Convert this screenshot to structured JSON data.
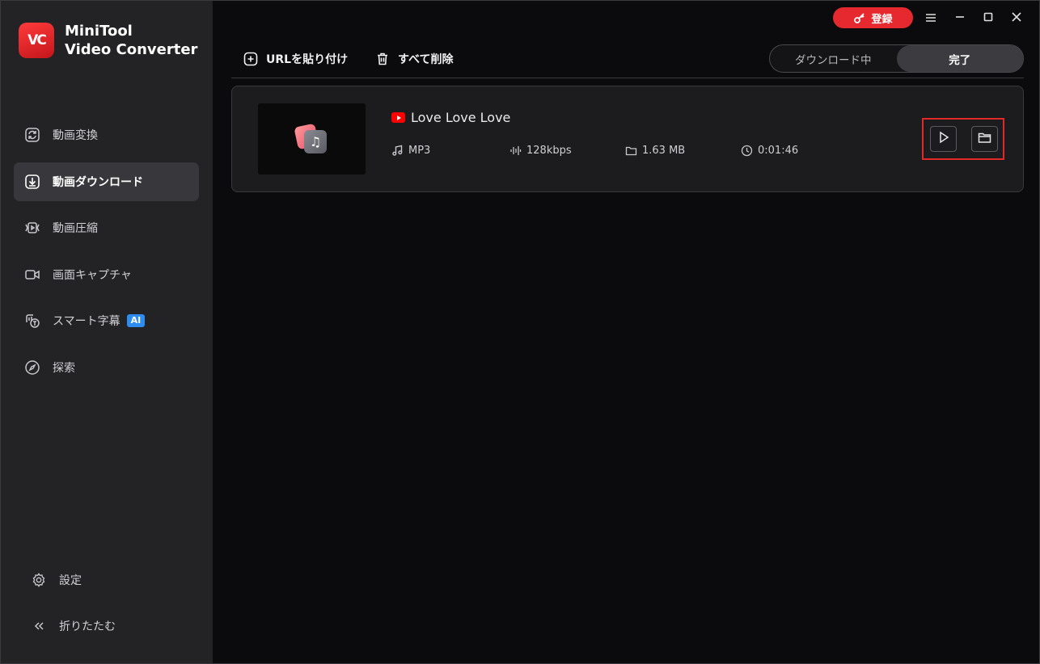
{
  "app": {
    "logo_mark": "VC",
    "name_line1": "MiniTool",
    "name_line2": "Video Converter"
  },
  "sidebar": {
    "items": [
      {
        "label": "動画変換",
        "icon": "refresh-icon"
      },
      {
        "label": "動画ダウンロード",
        "icon": "download-icon",
        "active": true
      },
      {
        "label": "動画圧縮",
        "icon": "compress-icon"
      },
      {
        "label": "画面キャプチャ",
        "icon": "camera-icon"
      },
      {
        "label": "スマート字幕",
        "icon": "subtitle-icon",
        "badge": "AI"
      },
      {
        "label": "探索",
        "icon": "compass-icon"
      }
    ],
    "bottom": [
      {
        "label": "設定",
        "icon": "gear-icon"
      },
      {
        "label": "折りたたむ",
        "icon": "collapse-icon"
      }
    ]
  },
  "titlebar": {
    "register_label": "登録"
  },
  "toolbar": {
    "paste_url_label": "URLを貼り付け",
    "delete_all_label": "すべて削除"
  },
  "tabs": [
    {
      "label": "ダウンロード中",
      "active": false
    },
    {
      "label": "完了",
      "active": true
    }
  ],
  "downloads": [
    {
      "title": "Love Love Love",
      "source_icon": "youtube-icon",
      "format": "MP3",
      "bitrate": "128kbps",
      "size": "1.63 MB",
      "duration": "0:01:46"
    }
  ],
  "colors": {
    "accent_red": "#e5292f",
    "sidebar_bg": "#232326",
    "main_bg": "#0b0b0d"
  }
}
